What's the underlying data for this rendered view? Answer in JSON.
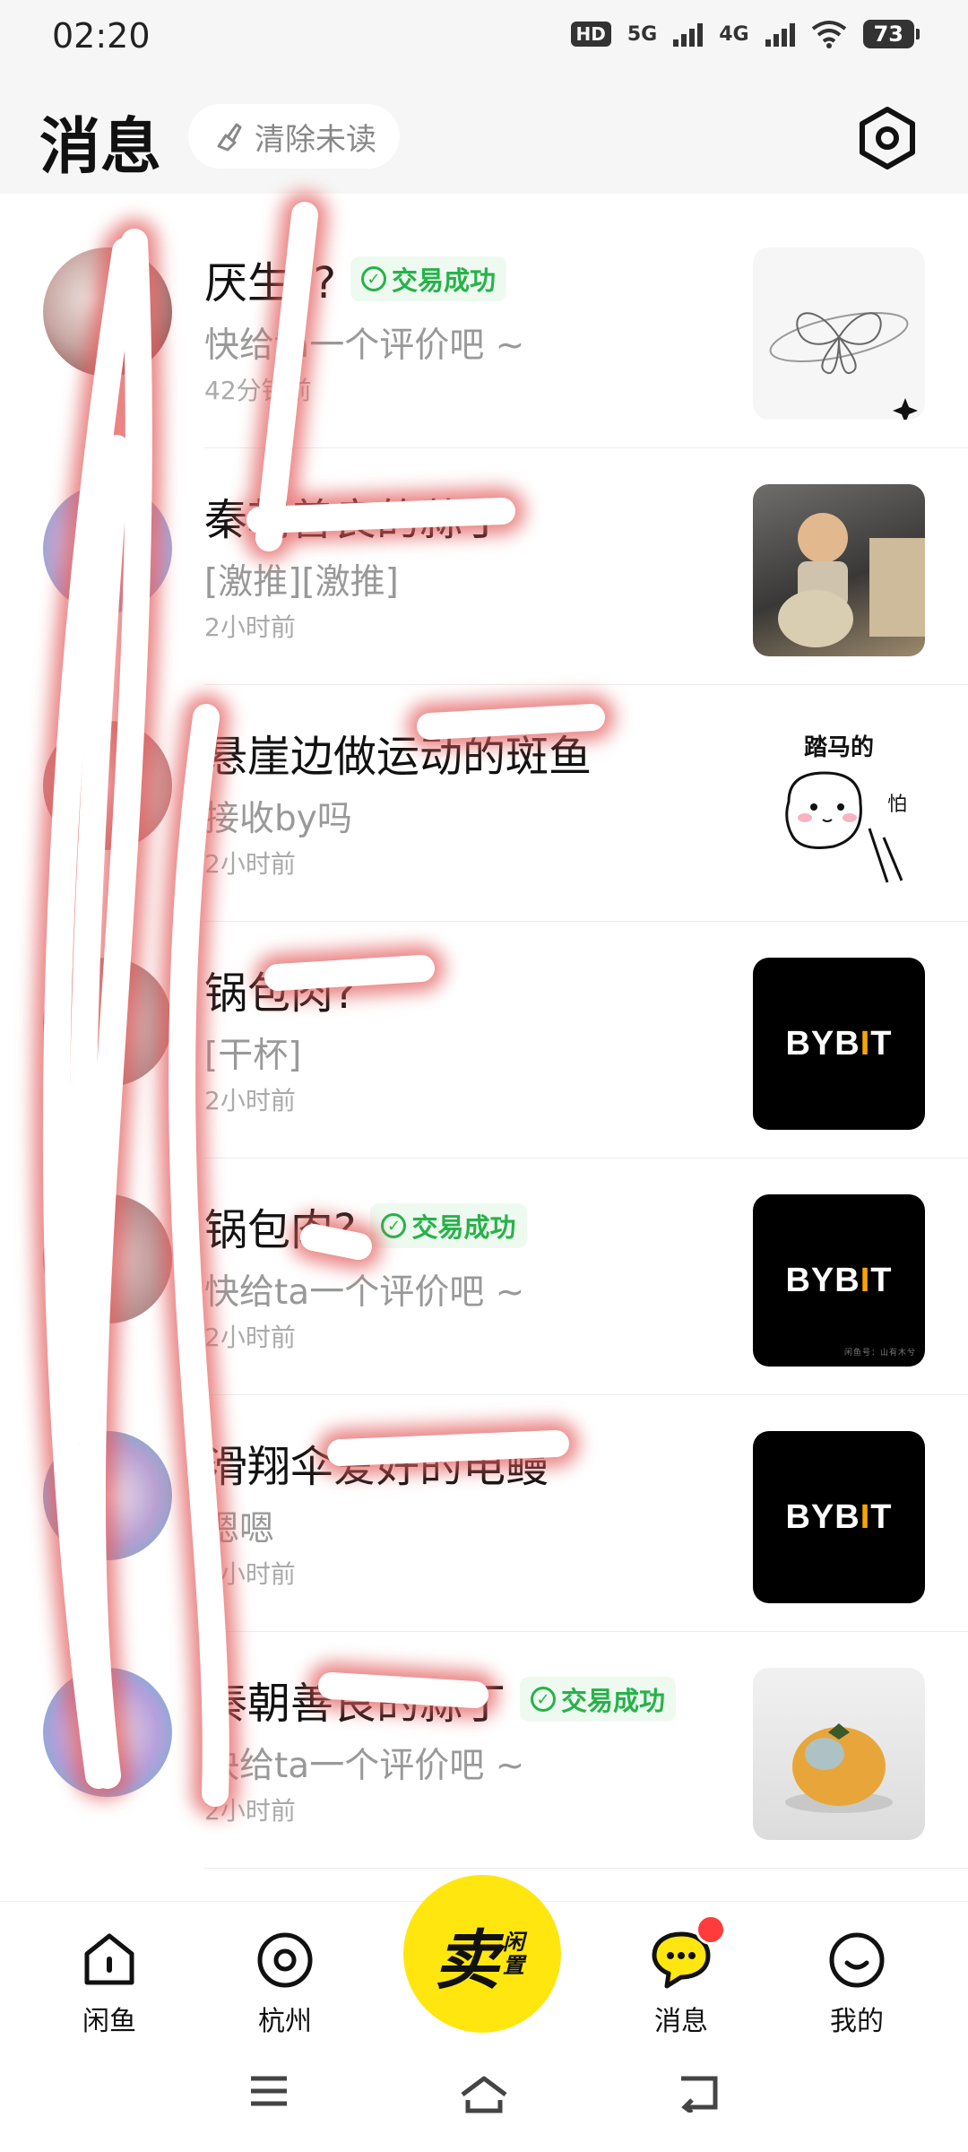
{
  "status_bar": {
    "time": "02:20",
    "hd_label": "HD",
    "net1": "5G",
    "net2": "4G",
    "battery": "73"
  },
  "header": {
    "title": "消息",
    "clear_unread": "清除未读"
  },
  "conversations": [
    {
      "name": "厌生??",
      "badge": "交易成功",
      "message": "快给ta一个评价吧 ~",
      "time": "42分钟前"
    },
    {
      "name": "秦朝善良的蒜丁",
      "badge": "",
      "message": "[激推][激推]",
      "time": "2小时前"
    },
    {
      "name": "悬崖边做运动的斑鱼",
      "badge": "",
      "message": "接收by吗",
      "time": "2小时前"
    },
    {
      "name": "锅包肉?",
      "badge": "",
      "message": "[干杯]",
      "time": "2小时前"
    },
    {
      "name": "锅包肉?",
      "badge": "交易成功",
      "message": "快给ta一个评价吧 ~",
      "time": "2小时前"
    },
    {
      "name": "滑翔伞爱好的电鳗",
      "badge": "",
      "message": "嗯嗯",
      "time": "2小时前"
    },
    {
      "name": "秦朝善良的蒜丁",
      "badge": "交易成功",
      "message": "快给ta一个评价吧 ~",
      "time": "2小时前"
    }
  ],
  "thumbs": {
    "sticker_text": "踏马的",
    "sticker_small": "怕",
    "bybit_left": "BYB",
    "bybit_bar": "I",
    "bybit_right": "T",
    "watermark": "闲鱼号：山有木兮"
  },
  "tabbar": {
    "home": "闲鱼",
    "city": "杭州",
    "sell_big": "卖",
    "sell_small": "闲置",
    "messages": "消息",
    "mine": "我的"
  },
  "colors": {
    "accent_yellow": "#ffe60f",
    "success_green": "#27b24a",
    "badge_red": "#ff3b3b"
  }
}
